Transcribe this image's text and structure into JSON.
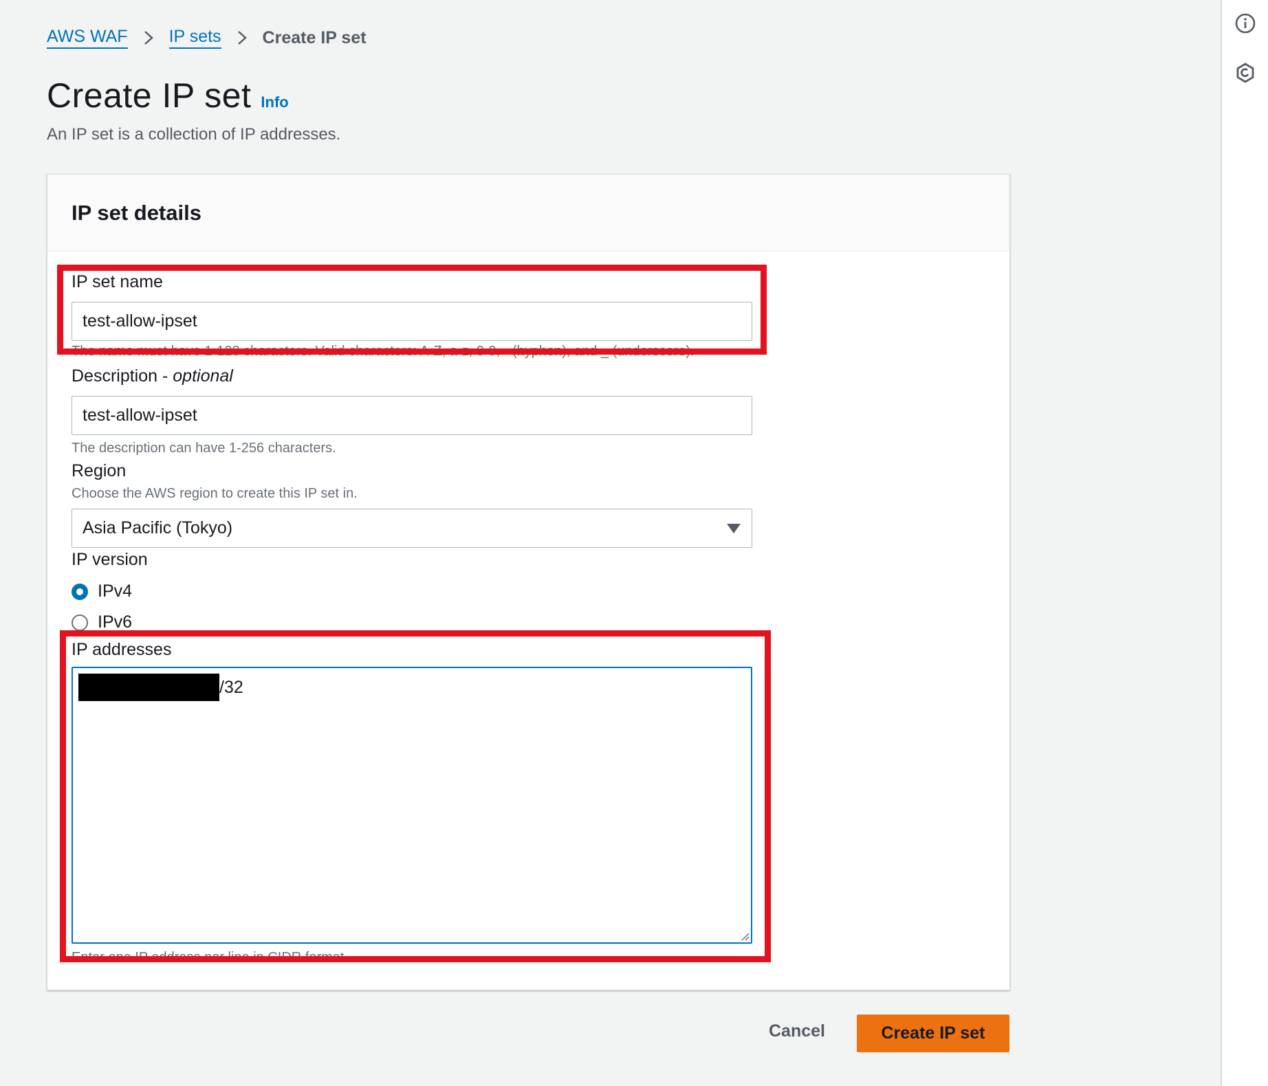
{
  "breadcrumb": {
    "items": [
      {
        "label": "AWS WAF"
      },
      {
        "label": "IP sets"
      }
    ],
    "current": "Create IP set"
  },
  "header": {
    "title": "Create IP set",
    "info_link": "Info",
    "description": "An IP set is a collection of IP addresses."
  },
  "panel": {
    "title": "IP set details",
    "name_field": {
      "label": "IP set name",
      "value": "test-allow-ipset",
      "hint": "The name must have 1-128 characters. Valid characters: A-Z, a-z, 0-9, - (hyphen), and _ (underscore)."
    },
    "description_field": {
      "label": "Description",
      "label_suffix": "optional",
      "value": "test-allow-ipset",
      "hint": "The description can have 1-256 characters."
    },
    "region_field": {
      "label": "Region",
      "hint": "Choose the AWS region to create this IP set in.",
      "value": "Asia Pacific (Tokyo)"
    },
    "ip_version": {
      "label": "IP version",
      "options": [
        {
          "label": "IPv4",
          "selected": true
        },
        {
          "label": "IPv6",
          "selected": false
        }
      ]
    },
    "ip_addresses": {
      "label": "IP addresses",
      "value_suffix": "/32",
      "hint": "Enter one IP address per line in CIDR format."
    }
  },
  "actions": {
    "cancel_label": "Cancel",
    "create_label": "Create IP set"
  },
  "colors": {
    "link": "#0073bb",
    "primary_button": "#ec7211",
    "highlight": "#e0131f",
    "background": "#f2f3f3"
  },
  "icons": {
    "rail_top": "info-circle-icon",
    "rail_bottom": "hexagon-settings-icon"
  }
}
